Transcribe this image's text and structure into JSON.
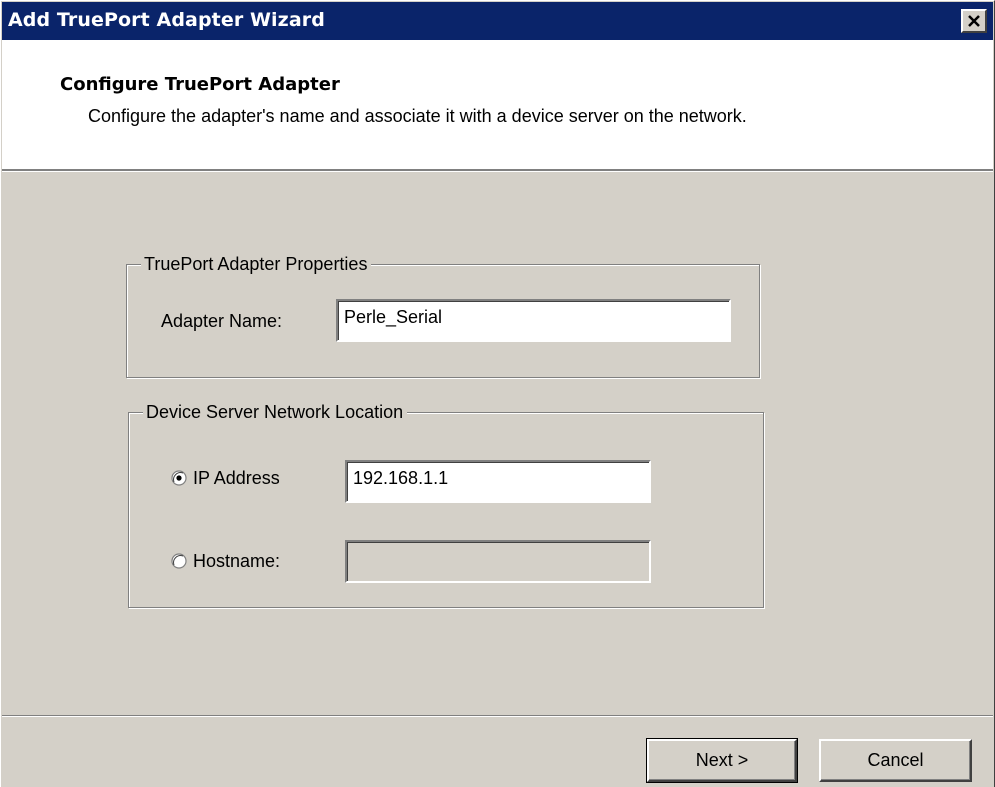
{
  "window": {
    "title": "Add TruePort Adapter Wizard",
    "close_icon": "close-icon"
  },
  "header": {
    "title": "Configure TruePort Adapter",
    "description": "Configure the adapter's name and associate it with a device server on the network."
  },
  "adapter_properties": {
    "legend": "TruePort Adapter Properties",
    "adapter_name_label": "Adapter Name:",
    "adapter_name_value": "Perle_Serial"
  },
  "network_location": {
    "legend": "Device Server Network Location",
    "ip_address_label": "IP Address",
    "ip_address_value": "192.168.1.1",
    "ip_address_selected": true,
    "hostname_label": "Hostname:",
    "hostname_value": "",
    "hostname_selected": false
  },
  "buttons": {
    "next_label": "Next >",
    "cancel_label": "Cancel"
  },
  "colors": {
    "titlebar": "#0a246a",
    "dialog_face": "#d4d0c8",
    "header_bg": "#ffffff"
  }
}
